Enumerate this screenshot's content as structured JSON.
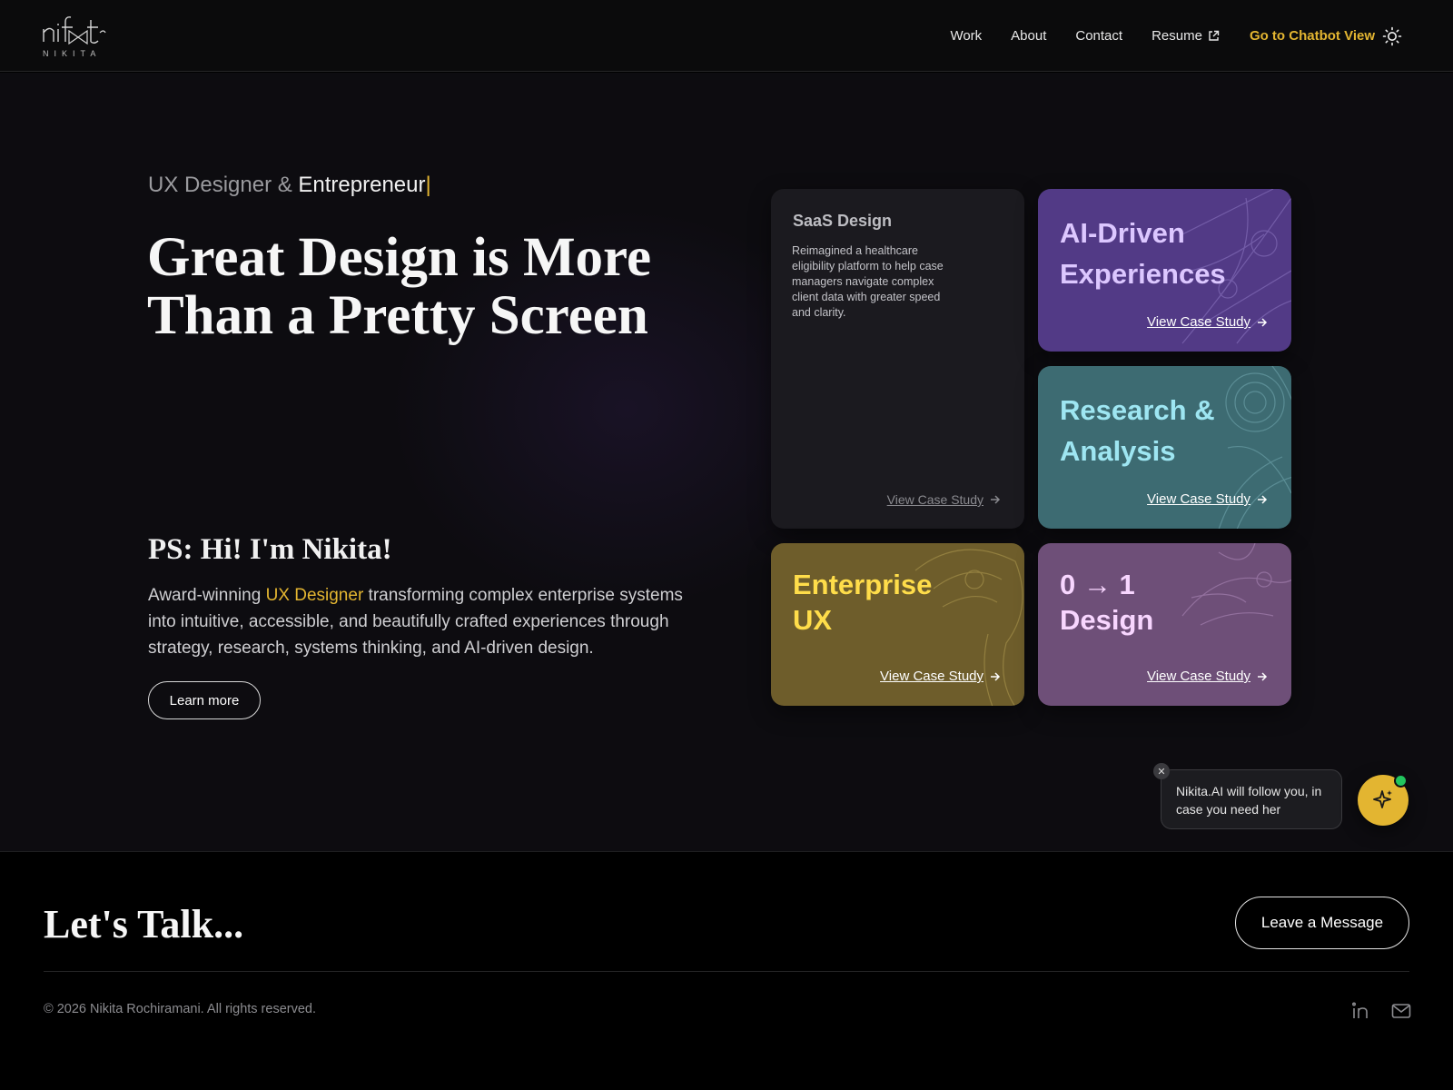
{
  "header": {
    "logo_text": "NIKITA",
    "nav": {
      "work": "Work",
      "about": "About",
      "contact": "Contact",
      "resume": "Resume",
      "chatbot": "Go to Chatbot View"
    }
  },
  "hero": {
    "role_prefix": "UX Designer & ",
    "role_emphasis": "Entrepreneur",
    "role_cursor": "|",
    "title": "Great Design is More Than a Pretty Screen",
    "ps_title": "PS: Hi! I'm Nikita!",
    "intro_before": "Award-winning ",
    "intro_highlight": "UX Designer",
    "intro_after": " transforming complex enterprise systems into intuitive, accessible, and beautifully crafted experiences through strategy, research, systems thinking, and AI-driven design.",
    "learn_more": "Learn more"
  },
  "cards": {
    "saas": {
      "title": "SaaS Design",
      "description": "Reimagined a healthcare eligibility platform to help case managers navigate complex client data with greater speed and clarity.",
      "link": "View Case Study"
    },
    "ai": {
      "title_line1": "AI-Driven",
      "title_line2": "Experiences",
      "link": "View Case Study"
    },
    "research": {
      "title_line1": "Research &",
      "title_line2": "Analysis",
      "link": "View Case Study"
    },
    "enterprise": {
      "title_line1": "Enterprise",
      "title_line2": "UX",
      "link": "View Case Study"
    },
    "zero": {
      "title_line1": "0 → 1",
      "title_line2": "Design",
      "link": "View Case Study"
    }
  },
  "chatbot": {
    "message": "Nikita.AI will follow you, in case you need her",
    "close_glyph": "✕"
  },
  "footer": {
    "talk_title": "Let's Talk...",
    "leave_message": "Leave a Message",
    "copyright": "© 2026 Nikita Rochiramani. All rights reserved."
  },
  "colors": {
    "accent": "#e3b531",
    "ai_card": "#523a86",
    "research_card": "#3d6b72",
    "enterprise_card": "#6e5d2b",
    "zero_card": "#6e4f78",
    "online_dot": "#22c55e"
  }
}
